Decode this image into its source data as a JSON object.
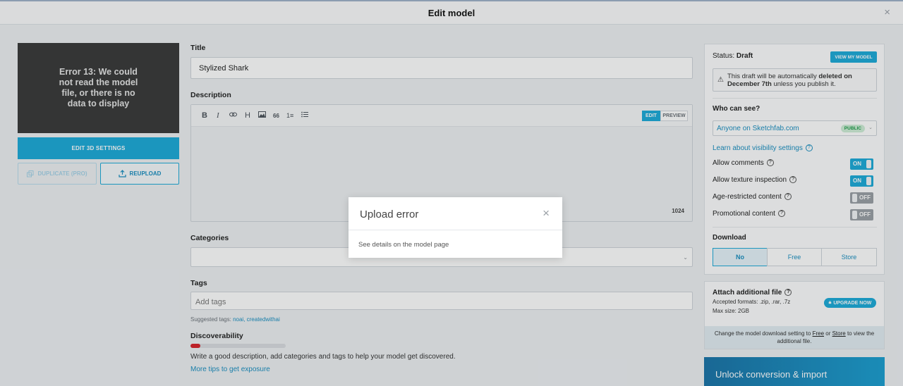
{
  "header": {
    "title": "Edit model",
    "close_glyph": "×"
  },
  "left": {
    "preview_error": "Error 13: We could not read the model file, or there is no data to display",
    "edit_3d_label": "EDIT 3D SETTINGS",
    "duplicate_label": "DUPLICATE (PRO)",
    "reupload_label": "REUPLOAD"
  },
  "form": {
    "title_label": "Title",
    "title_value": "Stylized Shark",
    "description_label": "Description",
    "toolbar_icons": [
      "B",
      "I",
      "🔗",
      "H",
      "▣",
      "66",
      "1≡",
      "≡"
    ],
    "edit_tab": "EDIT",
    "preview_tab": "PREVIEW",
    "char_count": "1024",
    "categories_label": "Categories",
    "tags_label": "Tags",
    "tags_placeholder": "Add tags",
    "suggested_prefix": "Suggested tags:",
    "suggested_tags": "noai, createdwithai",
    "discoverability_label": "Discoverability",
    "discoverability_progress": 0.1,
    "discoverability_text": "Write a good description, add categories and tags to help your model get discovered.",
    "more_tips": "More tips to get exposure"
  },
  "status": {
    "status_label": "Status:",
    "status_value": "Draft",
    "view_button": "VIEW MY MODEL",
    "notice_pre": "This draft will be automatically ",
    "notice_bold": "deleted on December 7th",
    "notice_post": " unless you publish it.",
    "who_can_see": "Who can see?",
    "visibility_value": "Anyone on Sketchfab.com",
    "visibility_badge": "PUBLIC",
    "learn_visibility": "Learn about visibility settings",
    "allow_comments": "Allow comments",
    "allow_comments_state": "ON",
    "allow_texture": "Allow texture inspection",
    "allow_texture_state": "ON",
    "age_restricted": "Age-restricted content",
    "age_restricted_state": "OFF",
    "promotional": "Promotional content",
    "promotional_state": "OFF",
    "download_label": "Download",
    "download_options": [
      "No",
      "Free",
      "Store"
    ]
  },
  "attach": {
    "title": "Attach additional file",
    "formats": "Accepted formats: .zip, .rar, .7z",
    "max_size": "Max size: 2GB",
    "upgrade_button": "UPGRADE NOW",
    "info_pre": "Change the model download setting to ",
    "info_free": "Free",
    "info_or": " or ",
    "info_store": "Store",
    "info_post": " to view the additional file."
  },
  "promo": {
    "text": "Unlock conversion & import"
  },
  "modal": {
    "title": "Upload error",
    "body": "See details on the model page",
    "close_glyph": "×"
  },
  "colors": {
    "accent": "#1caad9",
    "danger": "#d8222a",
    "public_badge": "#1f9d4a"
  }
}
